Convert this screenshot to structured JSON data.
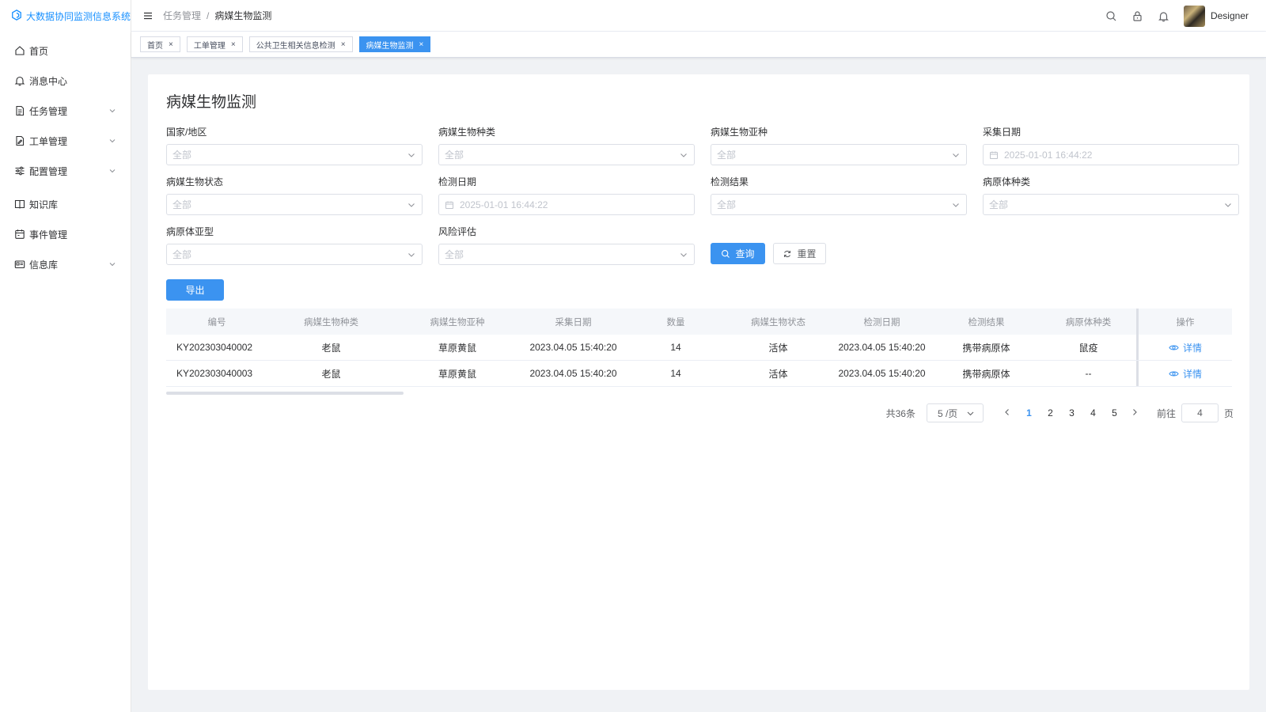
{
  "app": {
    "title": "大数据协同监测信息系统"
  },
  "sidebar": {
    "items": [
      {
        "label": "首页",
        "icon": "home-icon",
        "expandable": false
      },
      {
        "label": "消息中心",
        "icon": "bell-icon",
        "expandable": false
      },
      {
        "label": "任务管理",
        "icon": "document-icon",
        "expandable": true
      },
      {
        "label": "工单管理",
        "icon": "edit-doc-icon",
        "expandable": true
      },
      {
        "label": "配置管理",
        "icon": "sliders-icon",
        "expandable": true
      },
      {
        "label": "知识库",
        "icon": "book-icon",
        "expandable": false
      },
      {
        "label": "事件管理",
        "icon": "calendar-icon",
        "expandable": false
      },
      {
        "label": "信息库",
        "icon": "id-card-icon",
        "expandable": true
      }
    ]
  },
  "header": {
    "breadcrumb": {
      "parent": "任务管理",
      "separator": "/",
      "current": "病媒生物监测"
    },
    "user": {
      "name": "Designer"
    }
  },
  "tags": [
    {
      "label": "首页",
      "active": false
    },
    {
      "label": "工单管理",
      "active": false
    },
    {
      "label": "公共卫生相关信息检测",
      "active": false
    },
    {
      "label": "病媒生物监测",
      "active": true
    }
  ],
  "tag_close": "×",
  "page": {
    "title": "病媒生物监测"
  },
  "filters": {
    "country": {
      "label": "国家/地区",
      "placeholder": "全部"
    },
    "vector_type": {
      "label": "病媒生物种类",
      "placeholder": "全部"
    },
    "vector_subspecies": {
      "label": "病媒生物亚种",
      "placeholder": "全部"
    },
    "collect_date": {
      "label": "采集日期",
      "placeholder": "2025-01-01 16:44:22"
    },
    "vector_status": {
      "label": "病媒生物状态",
      "placeholder": "全部"
    },
    "detect_date": {
      "label": "检测日期",
      "placeholder": "2025-01-01 16:44:22"
    },
    "detect_result": {
      "label": "检测结果",
      "placeholder": "全部"
    },
    "pathogen_type": {
      "label": "病原体种类",
      "placeholder": "全部"
    },
    "pathogen_subtype": {
      "label": "病原体亚型",
      "placeholder": "全部"
    },
    "risk_assessment": {
      "label": "风险评估",
      "placeholder": "全部"
    }
  },
  "buttons": {
    "query": "查询",
    "reset": "重置",
    "export": "导出"
  },
  "table": {
    "columns": [
      "编号",
      "病媒生物种类",
      "病媒生物亚种",
      "采集日期",
      "数量",
      "病媒生物状态",
      "检测日期",
      "检测结果",
      "病原体种类",
      "操作"
    ],
    "rows": [
      [
        "KY202303040002",
        "老鼠",
        "草原黄鼠",
        "2023.04.05 15:40:20",
        "14",
        "活体",
        "2023.04.05 15:40:20",
        "携带病原体",
        "鼠疫",
        "详情"
      ],
      [
        "KY202303040003",
        "老鼠",
        "草原黄鼠",
        "2023.04.05 15:40:20",
        "14",
        "活体",
        "2023.04.05 15:40:20",
        "携带病原体",
        "--",
        "详情"
      ]
    ]
  },
  "pagination": {
    "total": "共36条",
    "page_size": "5 /页",
    "pages": [
      "1",
      "2",
      "3",
      "4",
      "5"
    ],
    "active_page": "1",
    "jump_label": "前往",
    "jump_value": "4",
    "jump_suffix": "页"
  },
  "colors": {
    "primary": "#3b93f0",
    "border": "#dcdfe6",
    "text": "#303133",
    "muted": "#909399"
  }
}
